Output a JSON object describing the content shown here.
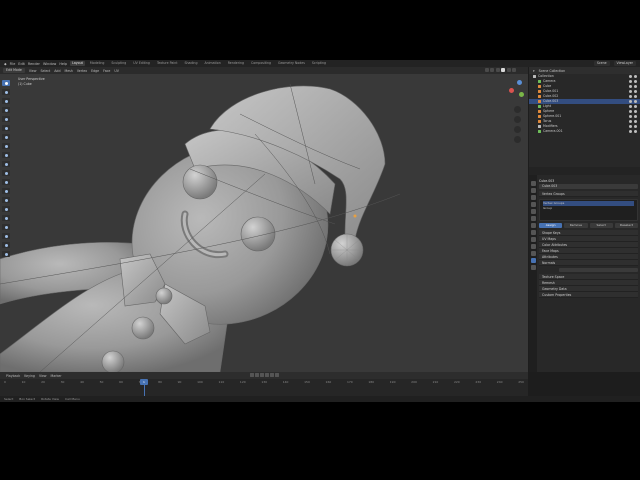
{
  "app": {
    "menus": [
      "File",
      "Edit",
      "Render",
      "Window",
      "Help"
    ],
    "workspace_tabs": [
      "Layout",
      "Modeling",
      "Sculpting",
      "UV Editing",
      "Texture Paint",
      "Shading",
      "Animation",
      "Rendering",
      "Compositing",
      "Geometry Nodes",
      "Scripting"
    ],
    "active_workspace": "Layout",
    "scene_name": "Scene",
    "view_layer": "ViewLayer"
  },
  "viewport": {
    "mode": "Edit Mode",
    "menus": [
      "View",
      "Select",
      "Add",
      "Mesh",
      "Vertex",
      "Edge",
      "Face",
      "UV"
    ],
    "overlay_line1": "User Perspective",
    "overlay_line2": "(1) Cube"
  },
  "outliner": {
    "title": "Scene Collection",
    "rows": [
      {
        "label": "Collection",
        "icon": "white",
        "selected": false
      },
      {
        "label": "Camera",
        "icon": "green",
        "selected": false
      },
      {
        "label": "Cube",
        "icon": "orange",
        "selected": false
      },
      {
        "label": "Cube.001",
        "icon": "orange",
        "selected": false
      },
      {
        "label": "Cube.002",
        "icon": "orange",
        "selected": false
      },
      {
        "label": "Cube.003",
        "icon": "orange",
        "selected": true
      },
      {
        "label": "Light",
        "icon": "green",
        "selected": false
      },
      {
        "label": "Sphere",
        "icon": "orange",
        "selected": false
      },
      {
        "label": "Sphere.001",
        "icon": "orange",
        "selected": false
      },
      {
        "label": "Torus",
        "icon": "orange",
        "selected": false
      },
      {
        "label": "Modifiers",
        "icon": "white",
        "selected": false
      },
      {
        "label": "Camera.001",
        "icon": "green",
        "selected": false
      }
    ]
  },
  "properties": {
    "object_name": "Cube.003",
    "data_name": "Cube.003",
    "sections": [
      "Vertex Groups",
      "Shape Keys",
      "UV Maps",
      "Color Attributes",
      "Face Maps",
      "Attributes",
      "Normals",
      "Texture Space",
      "Remesh",
      "Geometry Data",
      "Custom Properties"
    ],
    "list_items": [
      "Vertex Groups",
      "Group"
    ],
    "buttons": [
      "Assign",
      "Remove",
      "Select",
      "Deselect"
    ],
    "active_section": "Vertex Groups"
  },
  "timeline": {
    "menus": [
      "Playback",
      "Keying",
      "View",
      "Marker"
    ],
    "current_frame": "1",
    "ticks": [
      "0",
      "10",
      "20",
      "30",
      "40",
      "50",
      "60",
      "70",
      "80",
      "90",
      "100",
      "110",
      "120",
      "130",
      "140",
      "150",
      "160",
      "170",
      "180",
      "190",
      "200",
      "210",
      "220",
      "230",
      "240",
      "250"
    ]
  },
  "statusbar": {
    "items": [
      "Select",
      "Box Select",
      "Rotate View",
      "Call Menu"
    ]
  },
  "colors": {
    "accent": "#4772b3",
    "viewport_bg": "#393939",
    "panel_bg": "#282828"
  }
}
